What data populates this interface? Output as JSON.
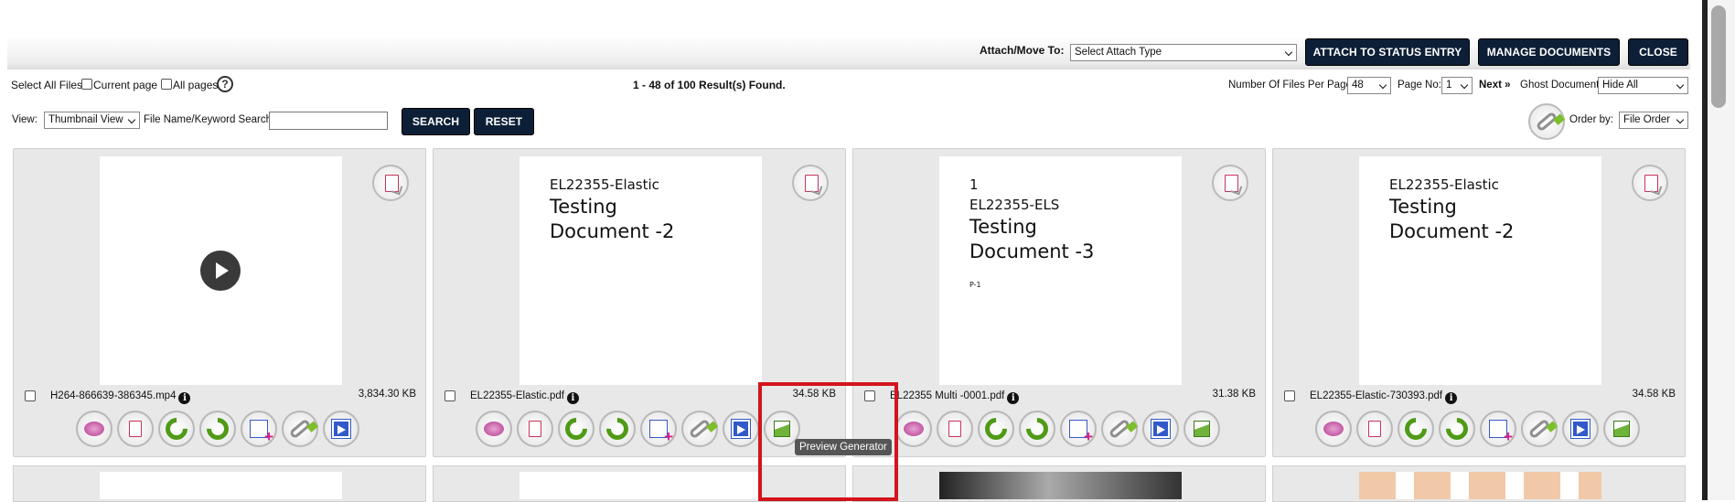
{
  "toolbar": {
    "attach_label": "Attach/Move To:",
    "attach_select_value": "Select Attach Type",
    "attach_status_button": "ATTACH TO STATUS ENTRY",
    "manage_documents_button": "MANAGE DOCUMENTS",
    "close_button": "CLOSE"
  },
  "selection": {
    "select_all_label": "Select All Files:",
    "current_page_label": "Current page",
    "all_pages_label": "All pages",
    "help_glyph": "?",
    "result_text": "1 - 48 of 100 Result(s) Found."
  },
  "paging": {
    "files_per_page_label": "Number Of Files Per Page:",
    "files_per_page_value": "48",
    "page_no_label": "Page No:",
    "page_no_value": "1",
    "next_link": "Next »",
    "ghost_label": "Ghost Document:",
    "ghost_value": "Hide All"
  },
  "filters": {
    "view_label": "View:",
    "view_value": "Thumbnail View",
    "search_label": "File Name/Keyword Search:",
    "search_value": "",
    "search_button": "SEARCH",
    "reset_button": "RESET",
    "order_label": "Order by:",
    "order_value": "File Order"
  },
  "cards": [
    {
      "type": "video",
      "file_name": "H264-866639-386345.mp4",
      "size": "3,834.30 KB",
      "doc_lines": []
    },
    {
      "type": "document",
      "file_name": "EL22355-Elastic.pdf",
      "size": "34.58 KB",
      "doc_lines": [
        "EL22355-Elastic",
        "Testing",
        "Document -2"
      ]
    },
    {
      "type": "document",
      "file_name": "EL22355 Multi -0001.pdf",
      "size": "31.38 KB",
      "doc_lines": [
        "1",
        "EL22355-ELS",
        "Testing",
        "Document -3",
        "P-1"
      ]
    },
    {
      "type": "document",
      "file_name": "EL22355-Elastic-730393.pdf",
      "size": "34.58 KB",
      "doc_lines": [
        "EL22355-Elastic",
        "Testing",
        "Document -2"
      ]
    }
  ],
  "info_glyph": "i",
  "tooltip": "Preview Generator",
  "colors": {
    "dark_button": "#0d1f36",
    "highlight": "#d4141c",
    "rotate_green": "#4f9a16",
    "comment_magenta": "#b13a8e"
  }
}
